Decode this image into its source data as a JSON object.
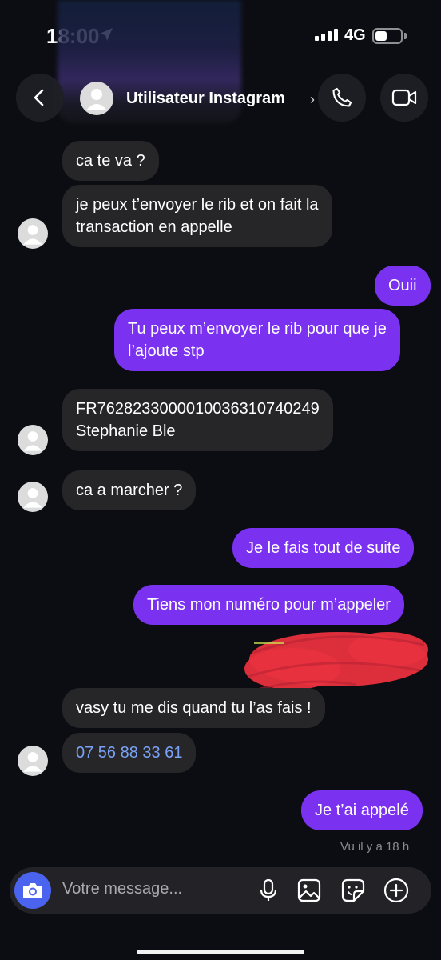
{
  "status": {
    "time": "18:00",
    "network": "4G"
  },
  "header": {
    "name": "Utilisateur Instagram"
  },
  "messages": {
    "m1": "ca te va ?",
    "m2_line1": "je peux t’envoyer le rib et on fait la",
    "m2_line2": "transaction en appelle",
    "m3": "Ouii",
    "m4_line1": "Tu peux m’envoyer le rib pour que je",
    "m4_line2": "l’ajoute stp",
    "m5_line1": "FR7628233000010036310740249",
    "m5_line2": "Stephanie Ble",
    "m6": "ca a marcher ?",
    "m7": "Je le fais tout de suite",
    "m8": "Tiens mon numéro pour m’appeler",
    "m9": "vasy tu me dis quand tu l’as fais !",
    "m10": "07 56 88 33 61",
    "m11": "Je t’ai appelé"
  },
  "seen": "Vu il y a 18 h",
  "composer": {
    "placeholder": "Votre message..."
  },
  "icons": {
    "back": "chevron-left-icon",
    "call": "phone-icon",
    "video": "video-camera-icon",
    "camera": "camera-icon",
    "mic": "microphone-icon",
    "gallery": "image-icon",
    "sticker": "sticker-icon",
    "add": "plus-circle-icon"
  },
  "colors": {
    "outgoing": "#7a32f0",
    "incoming": "#262628",
    "accent": "#4b64f0",
    "link": "#7aa2f7"
  }
}
